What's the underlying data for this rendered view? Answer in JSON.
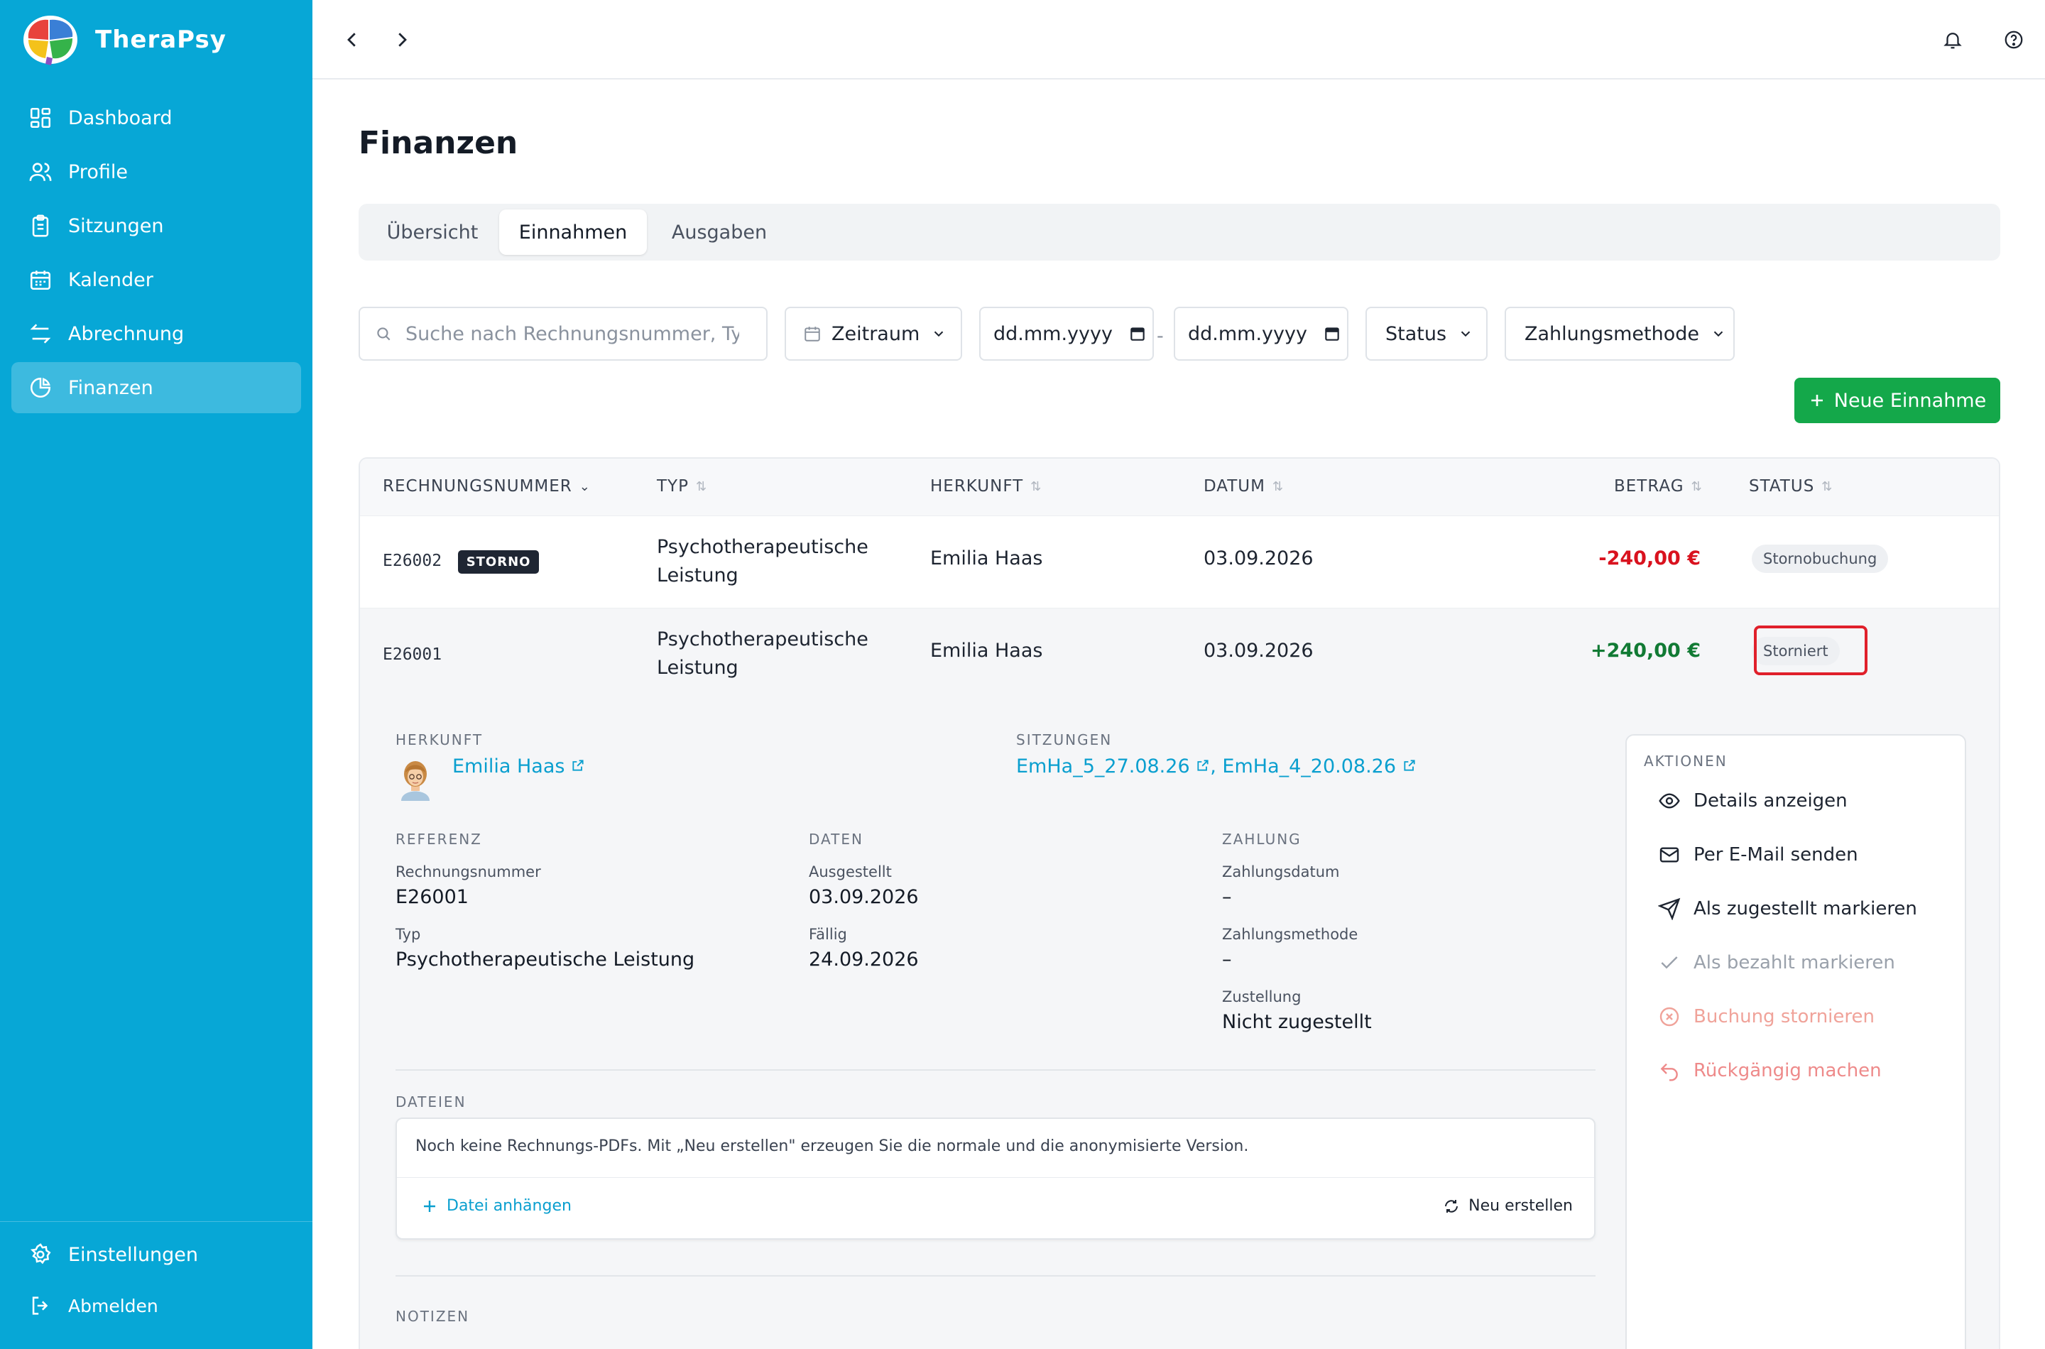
{
  "app": {
    "name": "TheraPsy"
  },
  "sidebar": {
    "items": [
      {
        "label": "Dashboard",
        "icon": "dashboard-icon"
      },
      {
        "label": "Profile",
        "icon": "users-icon"
      },
      {
        "label": "Sitzungen",
        "icon": "clipboard-icon"
      },
      {
        "label": "Kalender",
        "icon": "calendar-icon"
      },
      {
        "label": "Abrechnung",
        "icon": "arrows-exchange-icon"
      },
      {
        "label": "Finanzen",
        "icon": "pie-chart-icon",
        "active": true
      }
    ],
    "settings": "Einstellungen",
    "logout": "Abmelden"
  },
  "page": {
    "title": "Finanzen"
  },
  "tabs": [
    {
      "label": "Übersicht"
    },
    {
      "label": "Einnahmen",
      "active": true
    },
    {
      "label": "Ausgaben"
    }
  ],
  "filters": {
    "search_placeholder": "Suche nach Rechnungsnummer, Typ",
    "period": "Zeitraum",
    "date_from": "dd.mm.yyyy",
    "date_to": "dd.mm.yyyy",
    "dash": "-",
    "status": "Status",
    "payment_method": "Zahlungsmethode"
  },
  "new_button": "Neue Einnahme",
  "table": {
    "headers": [
      "RECHNUNGSNUMMER",
      "TYP",
      "HERKUNFT",
      "DATUM",
      "BETRAG",
      "STATUS"
    ],
    "rows": [
      {
        "number": "E26002",
        "badge": "STORNO",
        "type_line1": "Psychotherapeutische",
        "type_line2": "Leistung",
        "origin": "Emilia Haas",
        "date": "03.09.2026",
        "amount": "-240,00 €",
        "status": "Stornobuchung"
      },
      {
        "number": "E26001",
        "type_line1": "Psychotherapeutische",
        "type_line2": "Leistung",
        "origin": "Emilia Haas",
        "date": "03.09.2026",
        "amount": "+240,00 €",
        "status": "Storniert"
      }
    ]
  },
  "detail": {
    "origin_label": "HERKUNFT",
    "origin_name": "Emilia Haas",
    "sessions_label": "SITZUNGEN",
    "session1": "EmHa_5_27.08.26",
    "session_sep": ",",
    "session2": "EmHa_4_20.08.26",
    "reference_label": "REFERENZ",
    "invoice_number_label": "Rechnungsnummer",
    "invoice_number": "E26001",
    "type_label": "Typ",
    "type_value": "Psychotherapeutische Leistung",
    "dates_label": "DATEN",
    "issued_label": "Ausgestellt",
    "issued": "03.09.2026",
    "due_label": "Fällig",
    "due": "24.09.2026",
    "payment_label": "ZAHLUNG",
    "payment_date_label": "Zahlungsdatum",
    "payment_date": "–",
    "payment_method_label": "Zahlungsmethode",
    "payment_method": "–",
    "delivery_label": "Zustellung",
    "delivery": "Nicht zugestellt",
    "files_label": "DATEIEN",
    "files_note": "Noch keine Rechnungs-PDFs. Mit „Neu erstellen\" erzeugen Sie die normale und die anonymisierte Version.",
    "attach_file": "Datei anhängen",
    "regenerate": "Neu erstellen",
    "notes_label": "NOTIZEN"
  },
  "actions": {
    "label": "AKTIONEN",
    "items": [
      {
        "label": "Details anzeigen",
        "icon": "eye-icon"
      },
      {
        "label": "Per E-Mail senden",
        "icon": "mail-icon"
      },
      {
        "label": "Als zugestellt markieren",
        "icon": "send-icon"
      },
      {
        "label": "Als bezahlt markieren",
        "icon": "check-icon",
        "disabled": true
      },
      {
        "label": "Buchung stornieren",
        "icon": "x-circle-icon",
        "disabled": true
      },
      {
        "label": "Rückgängig machen",
        "icon": "undo-icon"
      }
    ]
  },
  "colors": {
    "sidebar": "#07a7d6",
    "primary_button": "#14a84a",
    "link": "#0a9fcf",
    "negative": "#d9121e",
    "positive": "#117a34"
  }
}
